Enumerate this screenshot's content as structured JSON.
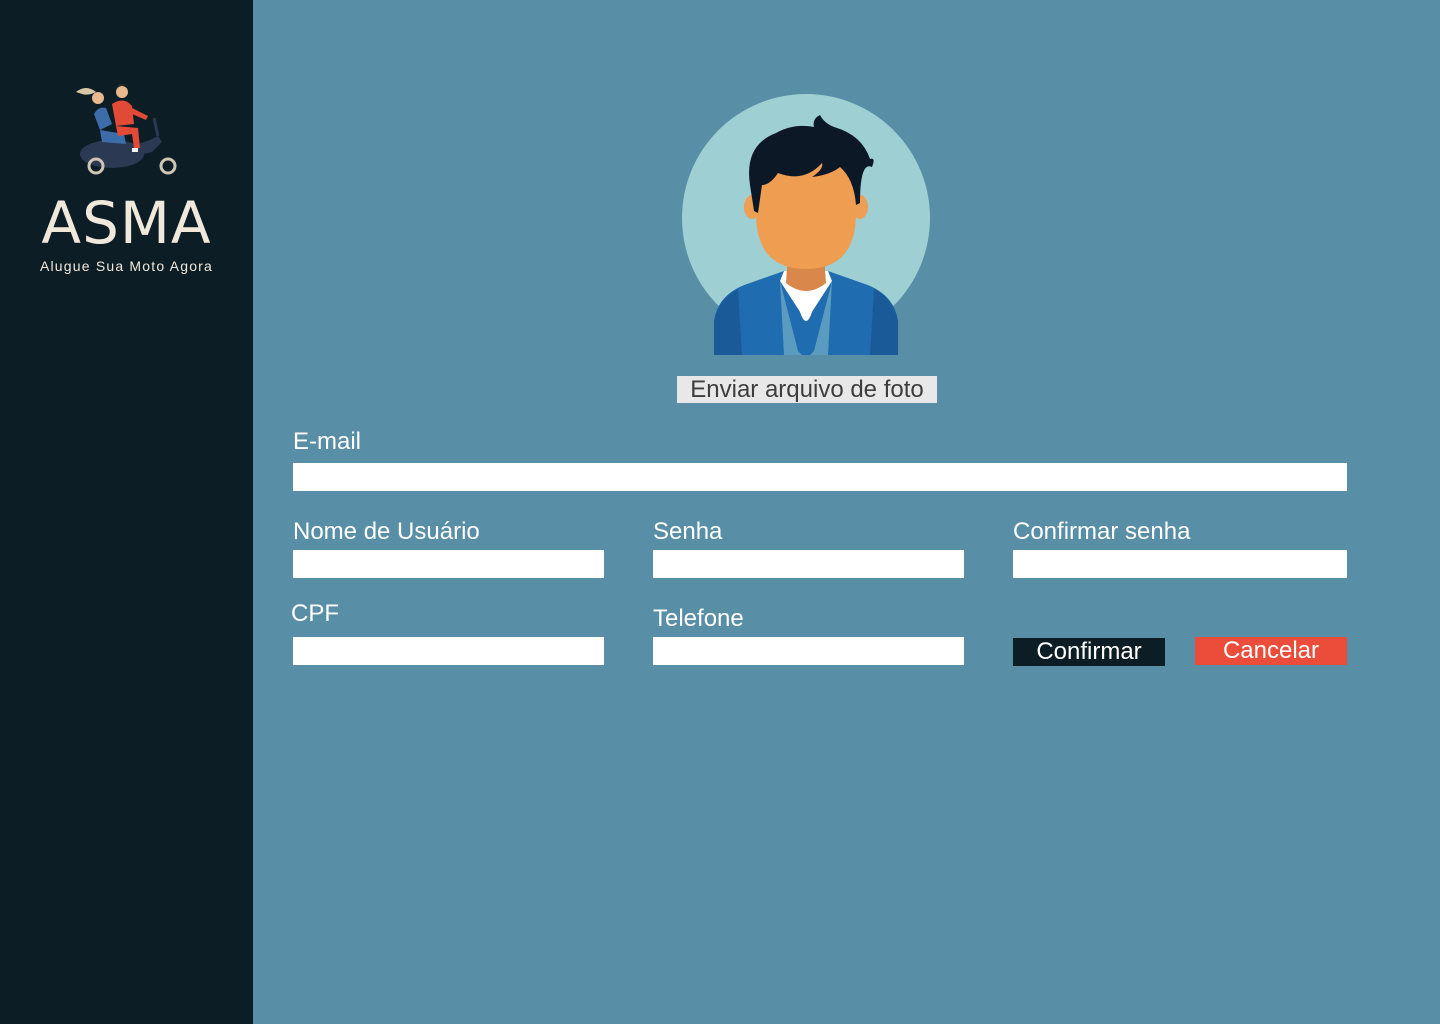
{
  "brand": {
    "name": "ASMA",
    "tagline": "Alugue Sua Moto Agora"
  },
  "profile": {
    "upload_label": "Enviar arquivo de foto"
  },
  "form": {
    "email_label": "E-mail",
    "email_value": "",
    "username_label": "Nome de Usuário",
    "username_value": "",
    "password_label": "Senha",
    "password_value": "",
    "confirm_password_label": "Confirmar senha",
    "confirm_password_value": "",
    "cpf_label": "CPF",
    "cpf_value": "",
    "phone_label": "Telefone",
    "phone_value": ""
  },
  "actions": {
    "confirm_label": "Confirmar",
    "cancel_label": "Cancelar"
  },
  "colors": {
    "sidebar": "#0d1d25",
    "background": "#588ea6",
    "cancel": "#ec4d3a",
    "brand_text": "#efe8db"
  },
  "icons": {
    "logo": "scooter-riders-illustration",
    "avatar": "user-avatar-icon"
  }
}
